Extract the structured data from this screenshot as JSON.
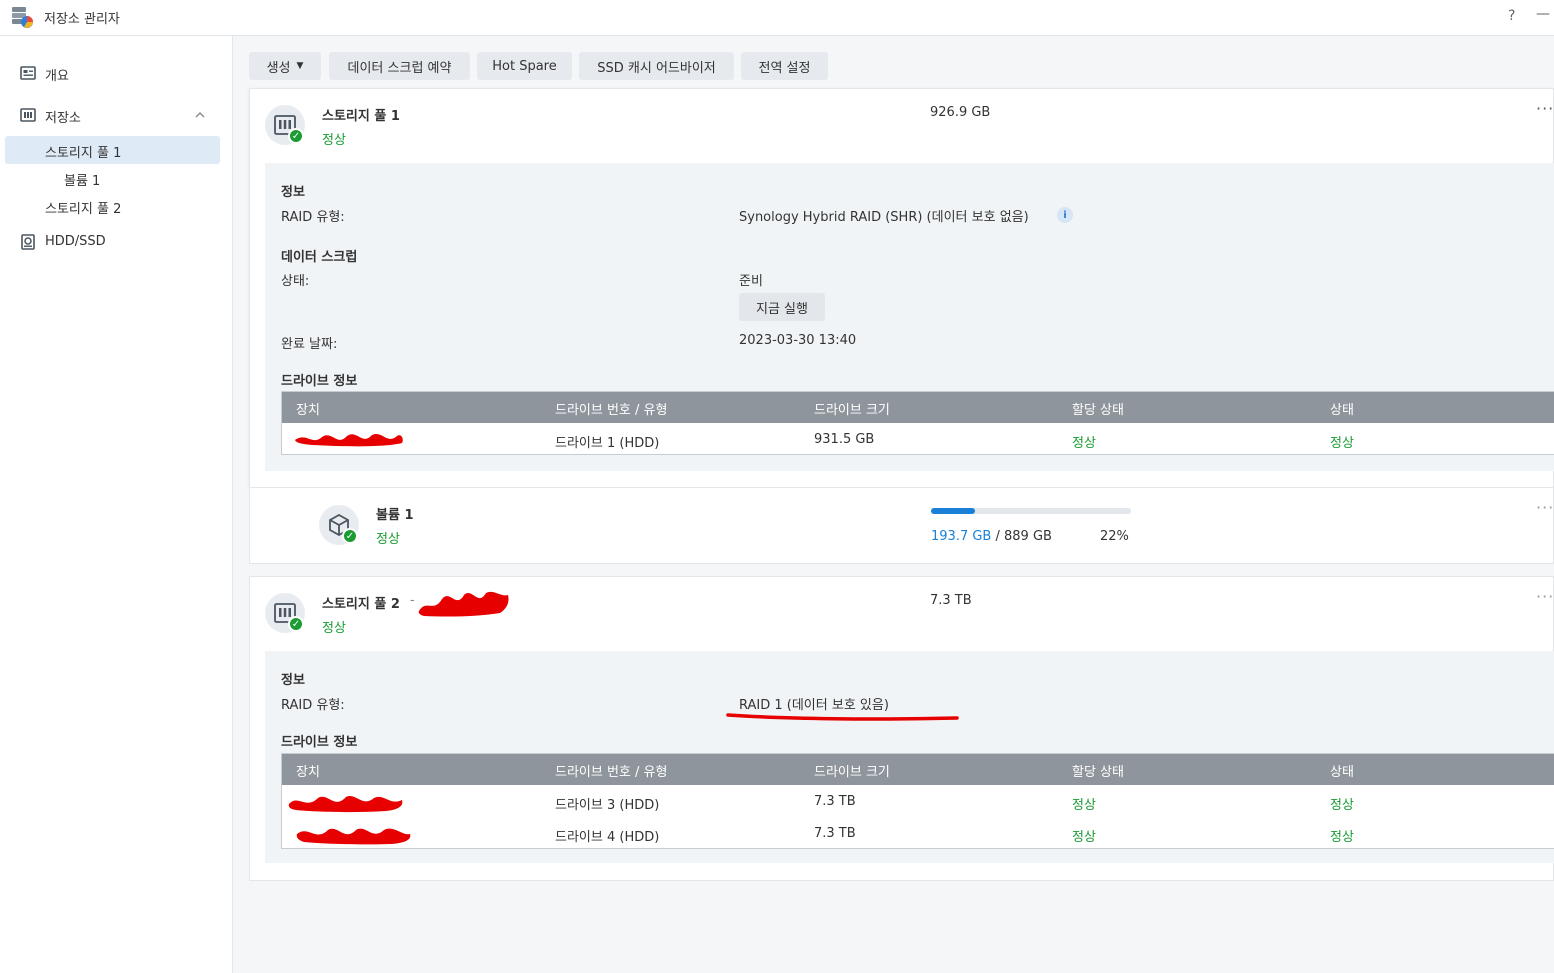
{
  "window": {
    "title": "저장소 관리자",
    "help": "?",
    "minimize": "—"
  },
  "sidebar": {
    "items": [
      {
        "label": "개요"
      },
      {
        "label": "저장소"
      },
      {
        "label": "스토리지 풀 1"
      },
      {
        "label": "볼륨 1"
      },
      {
        "label": "스토리지 풀 2"
      },
      {
        "label": "HDD/SSD"
      }
    ]
  },
  "toolbar": {
    "create": "생성",
    "scrub_schedule": "데이터 스크럽 예약",
    "hot_spare": "Hot Spare",
    "ssd_cache": "SSD 캐시 어드바이저",
    "global_settings": "전역 설정"
  },
  "pool1": {
    "name": "스토리지 풀 1",
    "status": "정상",
    "size": "926.9 GB",
    "more": "···",
    "info_title": "정보",
    "raid_label": "RAID 유형:",
    "raid_value": "Synology Hybrid RAID (SHR) (데이터 보호 없음)",
    "scrub_title": "데이터 스크럽",
    "state_label": "상태:",
    "state_value": "준비",
    "run_now": "지금 실행",
    "completed_label": "완료 날짜:",
    "completed_value": "2023-03-30 13:40",
    "drive_title": "드라이브 정보",
    "drives": [
      {
        "number": "드라이브 1 (HDD)",
        "size": "931.5 GB",
        "alloc": "정상",
        "status": "정상"
      }
    ]
  },
  "volume1": {
    "name": "볼륨 1",
    "status": "정상",
    "used": "193.7 GB",
    "sep": "/",
    "total": "889 GB",
    "percent": "22%",
    "usage_fraction": 0.22,
    "more": "···"
  },
  "pool2": {
    "name": "스토리지 풀 2",
    "name_suffix": "-",
    "status": "정상",
    "size": "7.3 TB",
    "more": "···",
    "info_title": "정보",
    "raid_label": "RAID 유형:",
    "raid_value": "RAID 1 (데이터 보호 있음)",
    "drive_title": "드라이브 정보",
    "drives": [
      {
        "number": "드라이브 3 (HDD)",
        "size": "7.3 TB",
        "alloc": "정상",
        "status": "정상"
      },
      {
        "number": "드라이브 4 (HDD)",
        "size": "7.3 TB",
        "alloc": "정상",
        "status": "정상"
      }
    ]
  },
  "table_headers": {
    "device": "장치",
    "number_type": "드라이브 번호 / 유형",
    "drive_size": "드라이브 크기",
    "alloc_status": "할당 상태",
    "status": "상태"
  },
  "colors": {
    "ok": "#1a9c33",
    "accent": "#1a7fd6",
    "redaction": "#e60000"
  }
}
